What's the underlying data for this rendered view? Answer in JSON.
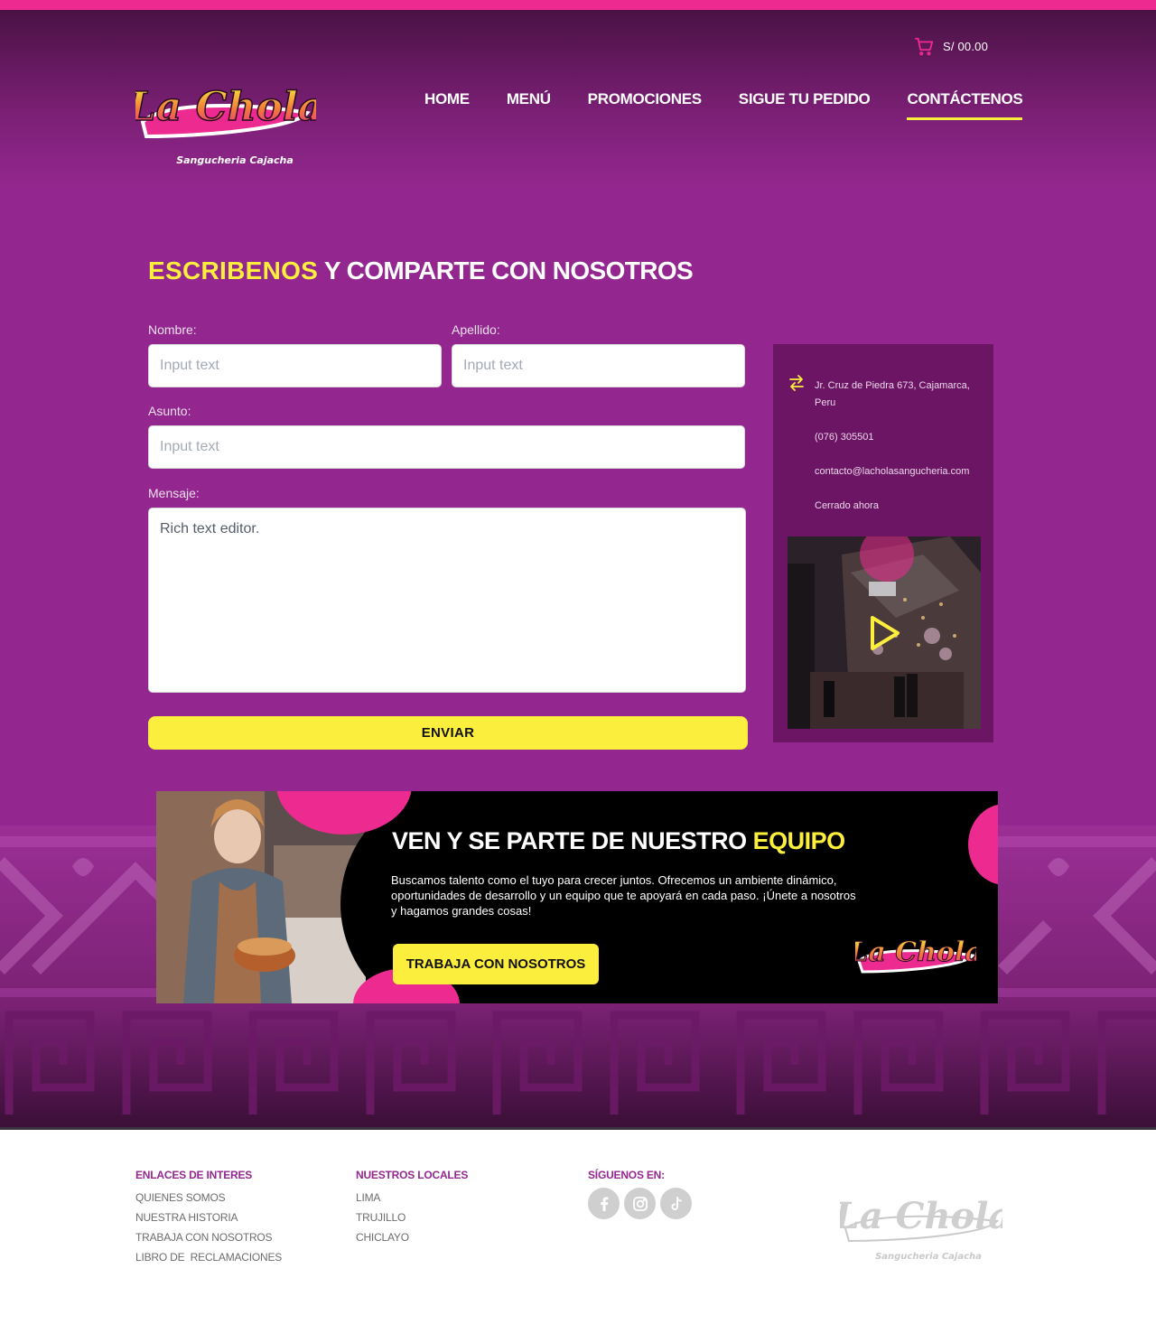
{
  "header": {
    "cart_total": "S/ 00.00",
    "logo_text": "La Chola",
    "logo_tagline": "Sangucheria Cajacha",
    "nav": [
      {
        "label": "HOME"
      },
      {
        "label": "MENÚ"
      },
      {
        "label": "PROMOCIONES"
      },
      {
        "label": "SIGUE TU PEDIDO"
      },
      {
        "label": "CONTÁCTENOS",
        "active": true
      }
    ]
  },
  "contact_form": {
    "title_highlight": "ESCRIBENOS",
    "title_rest": " Y COMPARTE CON NOSOTROS",
    "nombre_label": "Nombre:",
    "nombre_placeholder": "Input text",
    "apellido_label": "Apellido:",
    "apellido_placeholder": "Input text",
    "asunto_label": "Asunto:",
    "asunto_placeholder": "Input text",
    "mensaje_label": "Mensaje:",
    "mensaje_placeholder": "Rich text editor.",
    "submit_label": "ENVIAR"
  },
  "info_panel": {
    "address": "Jr. Cruz de Piedra 673, Cajamarca, Peru",
    "phone": "(076) 305501",
    "email": "contacto@lacholasangucheria.com",
    "status": "Cerrado ahora"
  },
  "banner": {
    "title_main": "VEN Y SE PARTE DE NUESTRO ",
    "title_highlight": "EQUIPO",
    "body": "Buscamos talento como el tuyo para crecer juntos. Ofrecemos un ambiente dinámico, oportunidades de desarrollo y un equipo que te apoyará en cada paso. ¡Únete a nosotros y hagamos grandes cosas!",
    "cta_label": "TRABAJA CON NOSOTROS"
  },
  "footer": {
    "links_title": "ENLACES DE INTERES",
    "links": [
      "QUIENES SOMOS",
      "NUESTRA HISTORIA",
      "TRABAJA CON NOSOTROS",
      "LIBRO DE  RECLAMACIONES"
    ],
    "locales_title": "NUESTROS LOCALES",
    "locales": [
      "LIMA",
      "TRUJILLO",
      "CHICLAYO"
    ],
    "social_title": "SÍGUENOS EN:",
    "social_icons": [
      "facebook-icon",
      "instagram-icon",
      "tiktok-icon"
    ]
  },
  "colors": {
    "brand_purple": "#93278f",
    "brand_pink": "#ec2a8f",
    "accent_yellow": "#fcee3c"
  }
}
